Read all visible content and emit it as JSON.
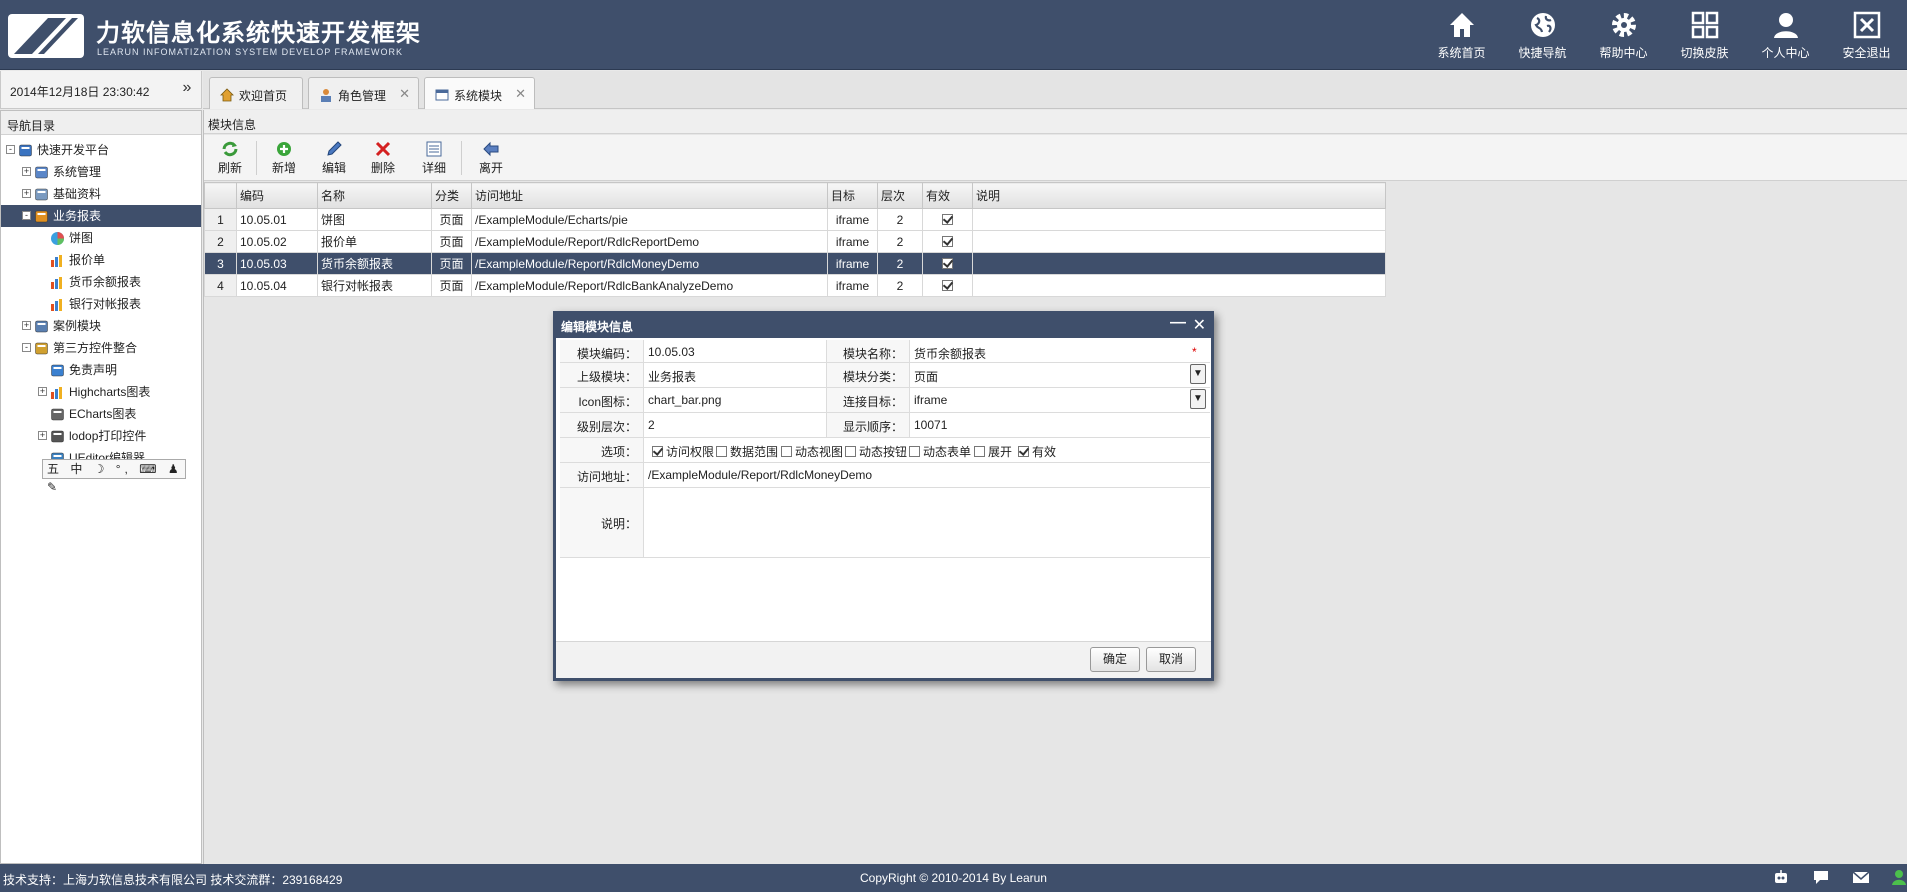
{
  "header": {
    "title": "力软信息化系统快速开发框架",
    "subtitle": "LEARUN INFOMATIZATION SYSTEM DEVELOP FRAMEWORK",
    "nav": [
      {
        "label": "系统首页",
        "icon": "home-icon"
      },
      {
        "label": "快捷导航",
        "icon": "globe-icon"
      },
      {
        "label": "帮助中心",
        "icon": "gear-icon"
      },
      {
        "label": "切换皮肤",
        "icon": "grid-icon"
      },
      {
        "label": "个人中心",
        "icon": "user-icon"
      },
      {
        "label": "安全退出",
        "icon": "close-box-icon"
      }
    ]
  },
  "datetime": "2014年12月18日 23:30:42",
  "collapse_glyph": "»",
  "tabs": [
    {
      "label": "欢迎首页",
      "closable": false
    },
    {
      "label": "角色管理",
      "closable": true
    },
    {
      "label": "系统模块",
      "closable": true,
      "active": true
    }
  ],
  "sidebar": {
    "title": "导航目录",
    "items": [
      {
        "label": "快速开发平台",
        "icon": "platform-icon",
        "toggle": "-"
      },
      {
        "label": "系统管理",
        "icon": "system-icon",
        "toggle": "+"
      },
      {
        "label": "基础资料",
        "icon": "tools-icon",
        "toggle": "+"
      },
      {
        "label": "业务报表",
        "icon": "report-icon",
        "toggle": "-",
        "selected": true
      },
      {
        "label": "饼图",
        "icon": "pie-icon"
      },
      {
        "label": "报价单",
        "icon": "chart-bar-icon"
      },
      {
        "label": "货币余额报表",
        "icon": "chart-bar-icon"
      },
      {
        "label": "银行对帐报表",
        "icon": "chart-bar-icon"
      },
      {
        "label": "案例模块",
        "icon": "case-icon",
        "toggle": "+"
      },
      {
        "label": "第三方控件整合",
        "icon": "package-icon",
        "toggle": "-"
      },
      {
        "label": "免责声明",
        "icon": "butterfly-icon"
      },
      {
        "label": "Highcharts图表",
        "icon": "chart-bar-icon",
        "toggle": "+"
      },
      {
        "label": "ECharts图表",
        "icon": "echarts-icon"
      },
      {
        "label": "lodop打印控件",
        "icon": "printer-icon",
        "toggle": "+"
      },
      {
        "label": "UEditor编辑器",
        "icon": "editor-icon"
      }
    ],
    "ime": "五 中 ☽ °, ⌨ ♟ ✎"
  },
  "main": {
    "panel_title": "模块信息",
    "toolbar": [
      {
        "label": "刷新",
        "icon": "refresh-icon"
      },
      {
        "label": "新增",
        "icon": "add-icon"
      },
      {
        "label": "编辑",
        "icon": "edit-icon"
      },
      {
        "label": "删除",
        "icon": "delete-icon"
      },
      {
        "label": "详细",
        "icon": "detail-icon"
      },
      {
        "label": "离开",
        "icon": "leave-icon"
      }
    ],
    "grid": {
      "columns": [
        "",
        "编码",
        "名称",
        "分类",
        "访问地址",
        "目标",
        "层次",
        "有效",
        "说明"
      ],
      "rows": [
        {
          "n": "1",
          "code": "10.05.01",
          "name": "饼图",
          "type": "页面",
          "url": "/ExampleModule/Echarts/pie",
          "target": "iframe",
          "level": "2",
          "valid": true,
          "note": ""
        },
        {
          "n": "2",
          "code": "10.05.02",
          "name": "报价单",
          "type": "页面",
          "url": "/ExampleModule/Report/RdlcReportDemo",
          "target": "iframe",
          "level": "2",
          "valid": true,
          "note": ""
        },
        {
          "n": "3",
          "code": "10.05.03",
          "name": "货币余额报表",
          "type": "页面",
          "url": "/ExampleModule/Report/RdlcMoneyDemo",
          "target": "iframe",
          "level": "2",
          "valid": true,
          "note": "",
          "selected": true
        },
        {
          "n": "4",
          "code": "10.05.04",
          "name": "银行对帐报表",
          "type": "页面",
          "url": "/ExampleModule/Report/RdlcBankAnalyzeDemo",
          "target": "iframe",
          "level": "2",
          "valid": true,
          "note": ""
        }
      ]
    }
  },
  "dialog": {
    "title": "编辑模块信息",
    "minimize": "—",
    "close": "✕",
    "fields": {
      "code_label": "模块编码：",
      "code_value": "10.05.03",
      "name_label": "模块名称：",
      "name_value": "货币余额报表",
      "parent_label": "上级模块：",
      "parent_value": "业务报表",
      "category_label": "模块分类：",
      "category_value": "页面",
      "icon_label": "Icon图标：",
      "icon_value": "chart_bar.png",
      "target_label": "连接目标：",
      "target_value": "iframe",
      "level_label": "级别层次：",
      "level_value": "2",
      "order_label": "显示顺序：",
      "order_value": "10071",
      "options_label": "选项：",
      "url_label": "访问地址：",
      "url_value": "/ExampleModule/Report/RdlcMoneyDemo",
      "note_label": "说明："
    },
    "required_mark": "*",
    "options": [
      {
        "label": "访问权限",
        "checked": true
      },
      {
        "label": "数据范围",
        "checked": false
      },
      {
        "label": "动态视图",
        "checked": false
      },
      {
        "label": "动态按钮",
        "checked": false
      },
      {
        "label": "动态表单",
        "checked": false
      },
      {
        "label": "展开",
        "checked": false
      },
      {
        "label": "有效",
        "checked": true
      }
    ],
    "ok_label": "确定",
    "cancel_label": "取消"
  },
  "status": {
    "support": "技术支持：上海力软信息技术有限公司    技术交流群：239168429",
    "copyright": "CopyRight © 2010-2014 By Learun"
  },
  "colors": {
    "accent": "#3f4f6b",
    "required": "#dd0000"
  }
}
